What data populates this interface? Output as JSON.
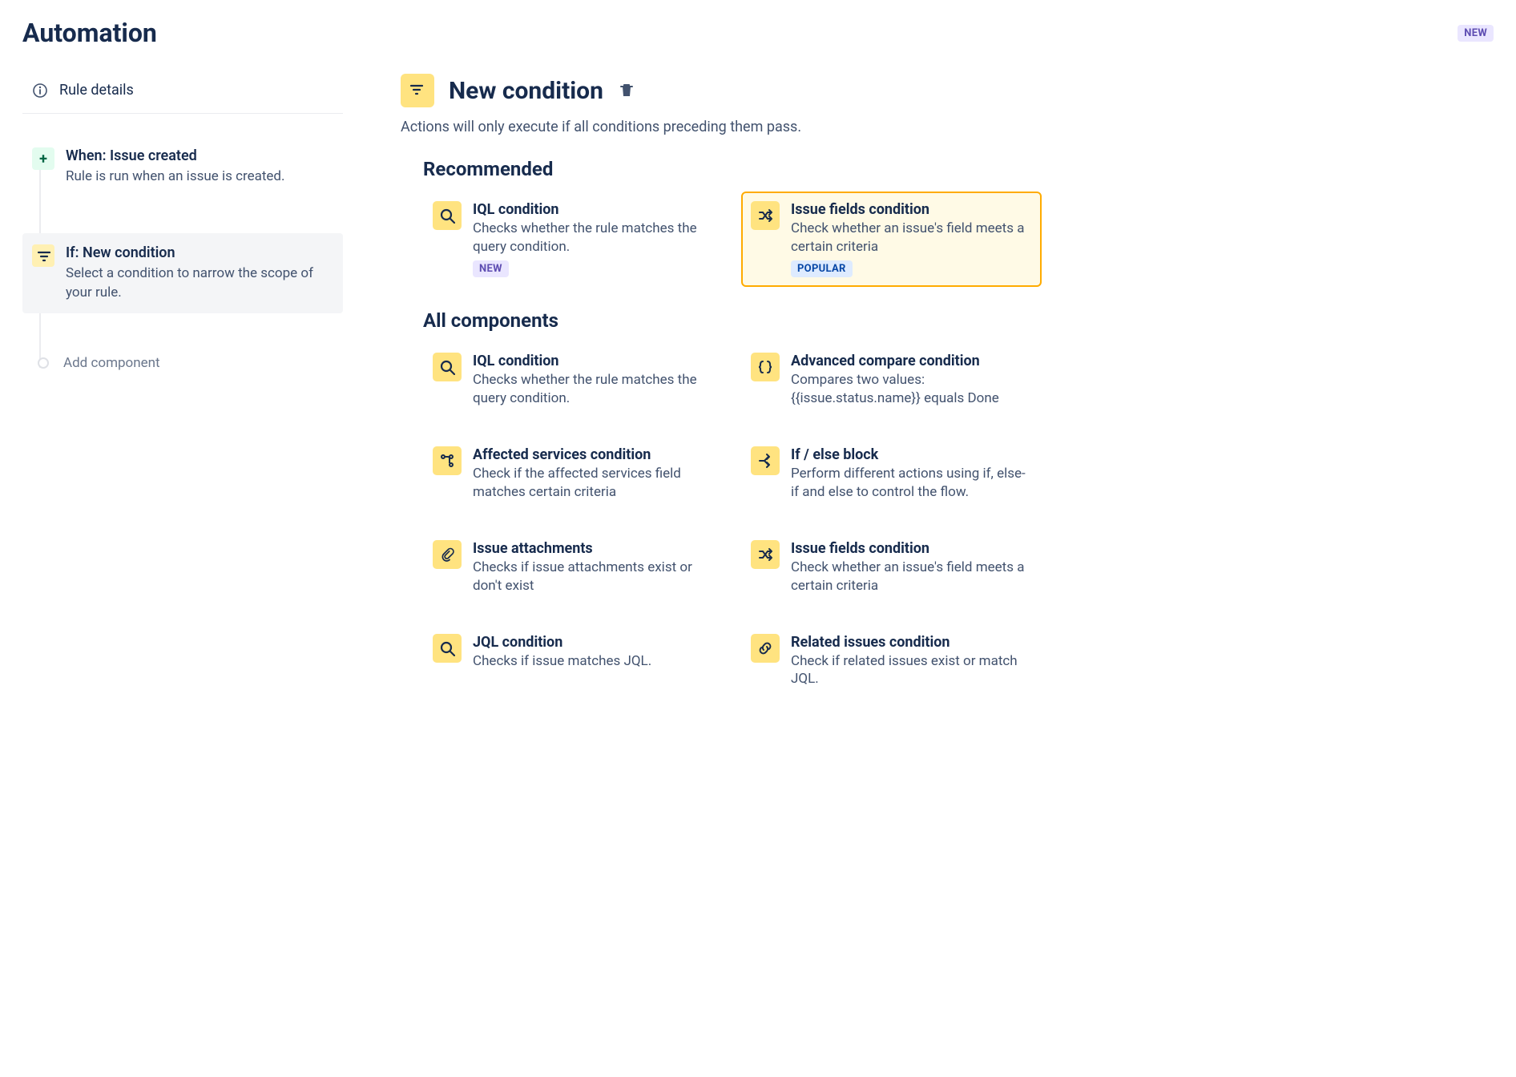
{
  "header": {
    "title": "Automation",
    "new_badge": "NEW"
  },
  "sidebar": {
    "rule_details": "Rule details",
    "steps": [
      {
        "icon": "plus",
        "kind": "trigger",
        "title": "When: Issue created",
        "desc": "Rule is run when an issue is created.",
        "selected": false
      },
      {
        "icon": "filter",
        "kind": "condition",
        "title": "If: New condition",
        "desc": "Select a condition to narrow the scope of your rule.",
        "selected": true
      }
    ],
    "add_component": "Add component"
  },
  "main": {
    "title": "New condition",
    "subtitle": "Actions will only execute if all conditions preceding them pass.",
    "sections": {
      "recommended": "Recommended",
      "all": "All components"
    },
    "recommended": [
      {
        "icon": "search",
        "title": "IQL condition",
        "desc": "Checks whether the rule matches the query condition.",
        "badge": "NEW",
        "badge_type": "new",
        "highlight": false
      },
      {
        "icon": "shuffle",
        "title": "Issue fields condition",
        "desc": "Check whether an issue's field meets a certain criteria",
        "badge": "POPULAR",
        "badge_type": "popular",
        "highlight": true
      }
    ],
    "all": [
      {
        "icon": "search",
        "title": "IQL condition",
        "desc": "Checks whether the rule matches the query condition."
      },
      {
        "icon": "braces",
        "title": "Advanced compare condition",
        "desc": "Compares two values: {{issue.status.name}} equals Done"
      },
      {
        "icon": "branch",
        "title": "Affected services condition",
        "desc": "Check if the affected services field matches certain criteria"
      },
      {
        "icon": "ifelse",
        "title": "If / else block",
        "desc": "Perform different actions using if, else-if and else to control the flow."
      },
      {
        "icon": "attachment",
        "title": "Issue attachments",
        "desc": "Checks if issue attachments exist or don't exist"
      },
      {
        "icon": "shuffle",
        "title": "Issue fields condition",
        "desc": "Check whether an issue's field meets a certain criteria"
      },
      {
        "icon": "search",
        "title": "JQL condition",
        "desc": "Checks if issue matches JQL."
      },
      {
        "icon": "link",
        "title": "Related issues condition",
        "desc": "Check if related issues exist or match JQL."
      }
    ]
  }
}
